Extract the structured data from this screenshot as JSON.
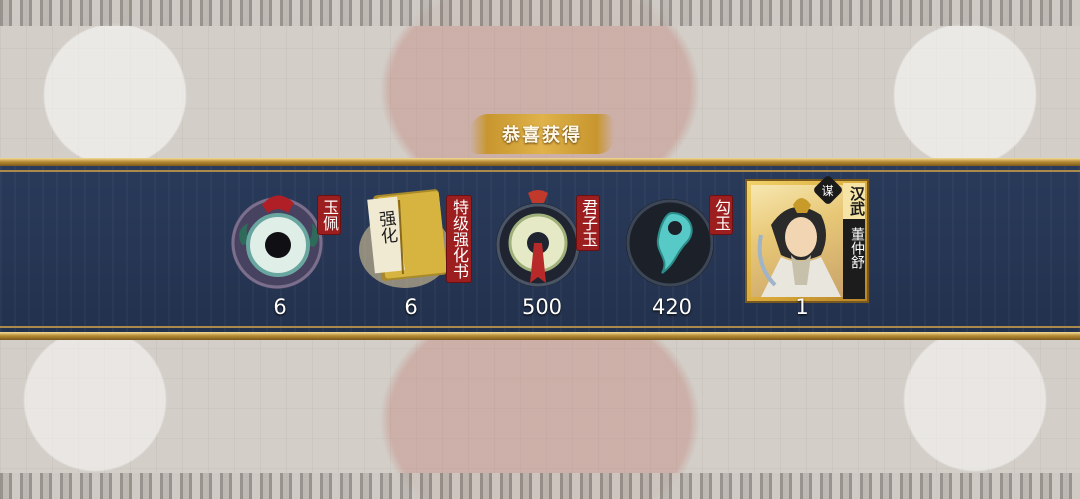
{
  "title": "恭喜获得",
  "rewards": [
    {
      "name": "玉佩",
      "count": "6",
      "icon": "jade-pendant-icon"
    },
    {
      "name": "特级强化书",
      "count": "6",
      "icon": "enhancement-book-icon",
      "book_text": "强化"
    },
    {
      "name": "君子玉",
      "count": "500",
      "icon": "gentleman-jade-icon"
    },
    {
      "name": "勾玉",
      "count": "420",
      "icon": "magatama-icon"
    },
    {
      "name": "董仲舒",
      "count": "1",
      "icon": "hero-portrait-icon",
      "faction": "汉武",
      "badge": "谋"
    }
  ],
  "colors": {
    "band": "#263654",
    "gold": "#c8962e",
    "tag_red": "#9c1e1e"
  }
}
